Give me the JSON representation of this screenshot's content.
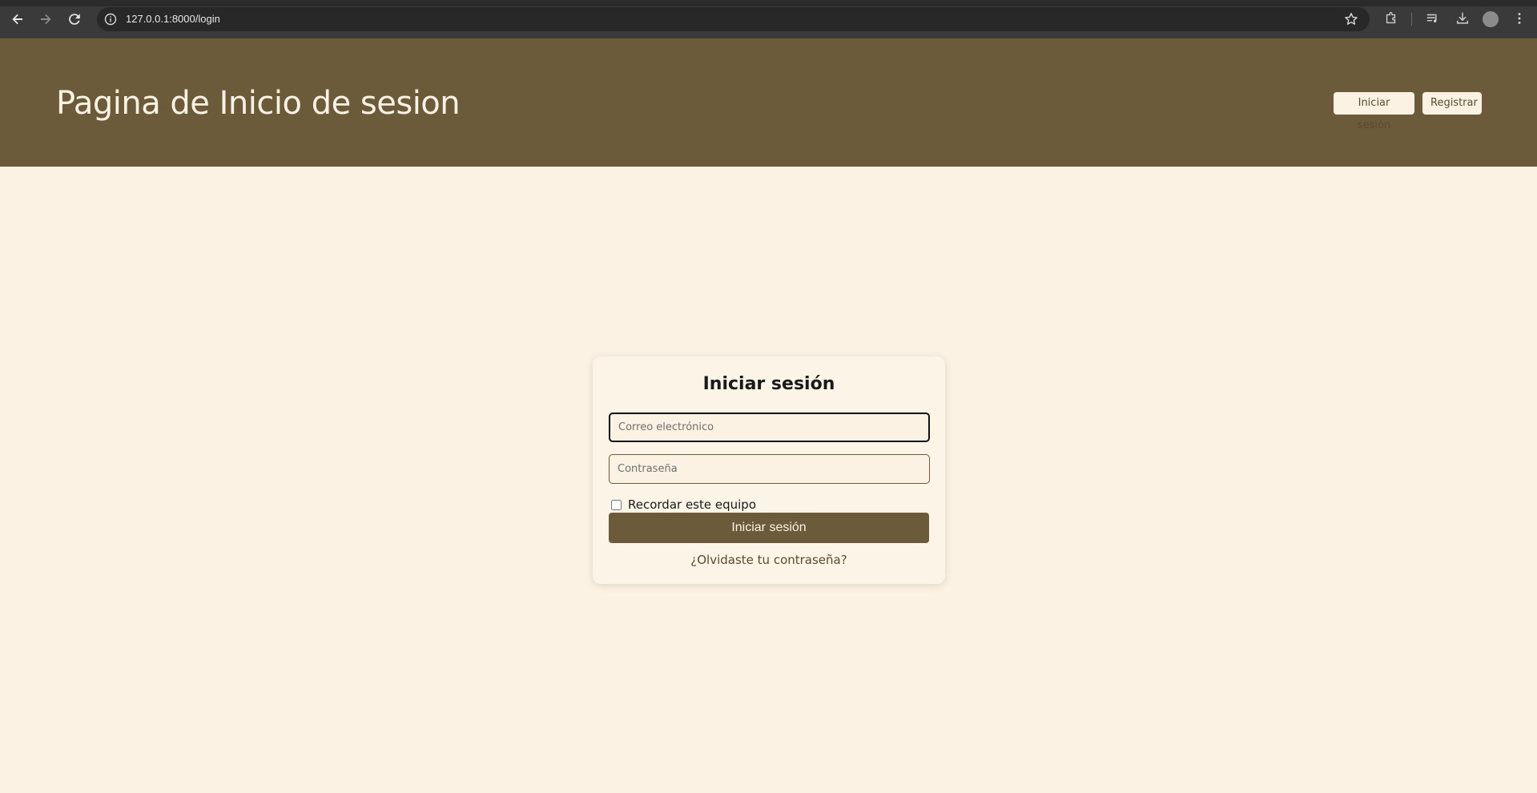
{
  "browser": {
    "url": "127.0.0.1:8000/login"
  },
  "header": {
    "title": "Pagina de Inicio de sesion",
    "login_label": "Iniciar sesión",
    "register_label": "Registrar"
  },
  "login_form": {
    "title": "Iniciar sesión",
    "email_placeholder": "Correo electrónico",
    "email_value": "",
    "password_placeholder": "Contraseña",
    "password_value": "",
    "remember_label": "Recordar este equipo",
    "remember_checked": false,
    "submit_label": "Iniciar sesión",
    "forgot_label": "¿Olvidaste tu contraseña?"
  },
  "colors": {
    "header_bg": "#6b5b3a",
    "page_bg": "#fbf2e3",
    "accent": "#6b5b3a"
  }
}
